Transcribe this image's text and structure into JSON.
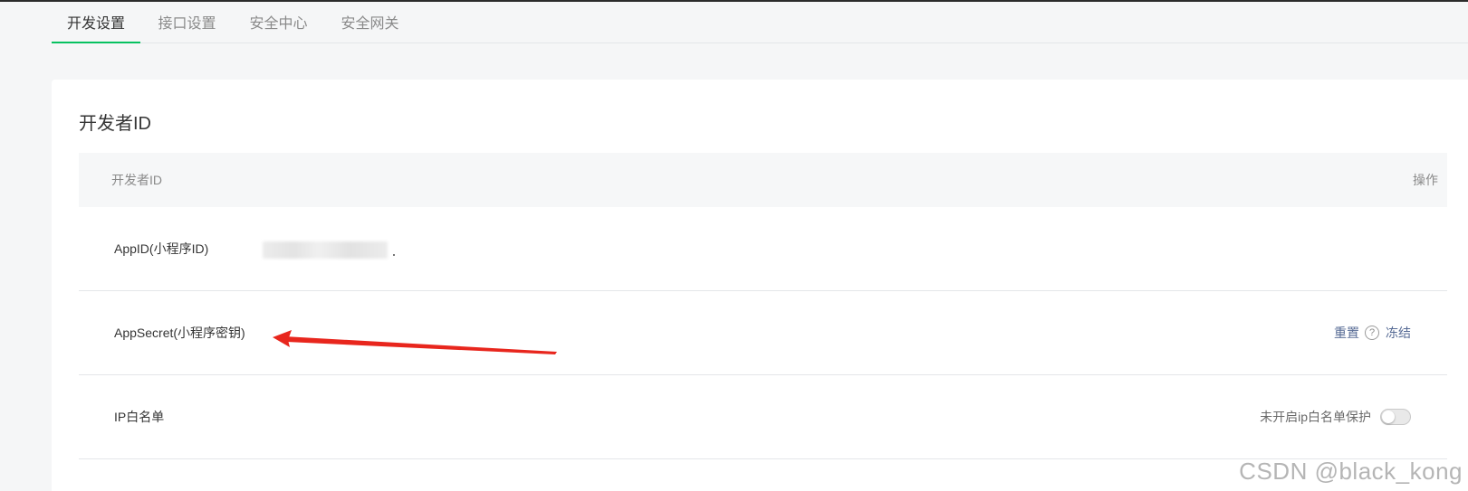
{
  "tabs": [
    {
      "label": "开发设置",
      "active": true
    },
    {
      "label": "接口设置",
      "active": false
    },
    {
      "label": "安全中心",
      "active": false
    },
    {
      "label": "安全网关",
      "active": false
    }
  ],
  "card": {
    "title": "开发者ID",
    "table": {
      "header_id": "开发者ID",
      "header_action": "操作"
    },
    "rows": {
      "appid_label": "AppID(小程序ID)",
      "secret_label": "AppSecret(小程序密钥)",
      "reset_label": "重置",
      "help_glyph": "?",
      "freeze_label": "冻结",
      "ip_label": "IP白名单",
      "ip_status": "未开启ip白名单保护"
    }
  },
  "watermark": "CSDN @black_kong",
  "colors": {
    "accent": "#07c160",
    "link": "#576b95",
    "annotation_arrow": "#e8261d"
  }
}
